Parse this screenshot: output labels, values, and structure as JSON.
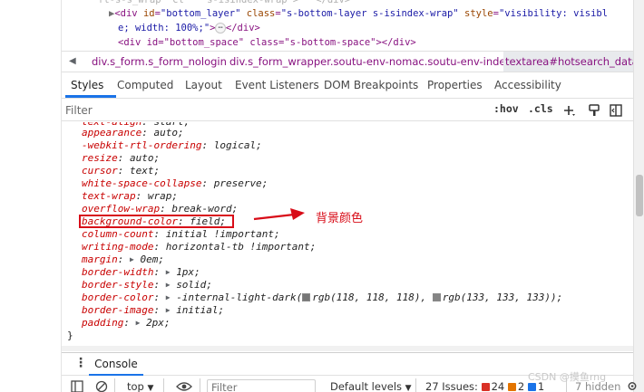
{
  "elements": {
    "line0": "ft-s-s_wrap  cl    s-isindex-wrap\">   </div>",
    "line1": {
      "open": "<div id=\"bottom_layer\" class=\"s-bottom-layer s-isindex-wrap\" style=\"visibility: visible; width: 100%;\">",
      "ellipsis": "⋯",
      "close": "</div>"
    },
    "line2": "<div id=\"bottom_space\" class=\"s-bottom-space\"></div>"
  },
  "breadcrumb": {
    "items": [
      "div.s_form.s_form_nologin",
      "div.s_form_wrapper.soutu-env-nomac.soutu-env-index",
      "textarea#hotsearch_data"
    ]
  },
  "tabs": [
    "Styles",
    "Computed",
    "Layout",
    "Event Listeners",
    "DOM Breakpoints",
    "Properties",
    "Accessibility"
  ],
  "filter": {
    "placeholder": "Filter",
    "hov": ":hov",
    "cls": ".cls"
  },
  "declarations": [
    {
      "name": "text-align",
      "value": "start",
      "partial": true
    },
    {
      "name": "appearance",
      "value": "auto"
    },
    {
      "name": "-webkit-rtl-ordering",
      "value": "logical"
    },
    {
      "name": "resize",
      "value": "auto"
    },
    {
      "name": "cursor",
      "value": "text"
    },
    {
      "name": "white-space-collapse",
      "value": "preserve"
    },
    {
      "name": "text-wrap",
      "value": "wrap"
    },
    {
      "name": "overflow-wrap",
      "value": "break-word"
    },
    {
      "name": "background-color",
      "value": "field"
    },
    {
      "name": "column-count",
      "value": "initial !important"
    },
    {
      "name": "writing-mode",
      "value": "horizontal-tb !important"
    },
    {
      "name": "margin",
      "value": "0em",
      "expand": true
    },
    {
      "name": "border-width",
      "value": "1px",
      "expand": true
    },
    {
      "name": "border-style",
      "value": "solid",
      "expand": true
    },
    {
      "name": "border-color",
      "value_pre": "-internal-light-dark(",
      "color1": "rgb(118, 118, 118)",
      "swatch1": "#767676",
      "color2": "rgb(133, 133, 133)",
      "swatch2": "#858585",
      "value_post": ");",
      "expand": true
    },
    {
      "name": "border-image",
      "value": "initial",
      "expand": true
    },
    {
      "name": "padding",
      "value": "2px",
      "expand": true
    }
  ],
  "close_brace": "}",
  "annotation": {
    "text": "背景颜色",
    "color": "#d80c18"
  },
  "console": {
    "tab": "Console",
    "context": "top",
    "filter_placeholder": "Filter",
    "levels": "Default levels",
    "issues_label": "27 Issues:",
    "issues_red": "24",
    "issues_yellow": "2",
    "issues_blue": "1",
    "hidden": "7 hidden"
  },
  "watermark": "CSDN @摸鱼rng"
}
